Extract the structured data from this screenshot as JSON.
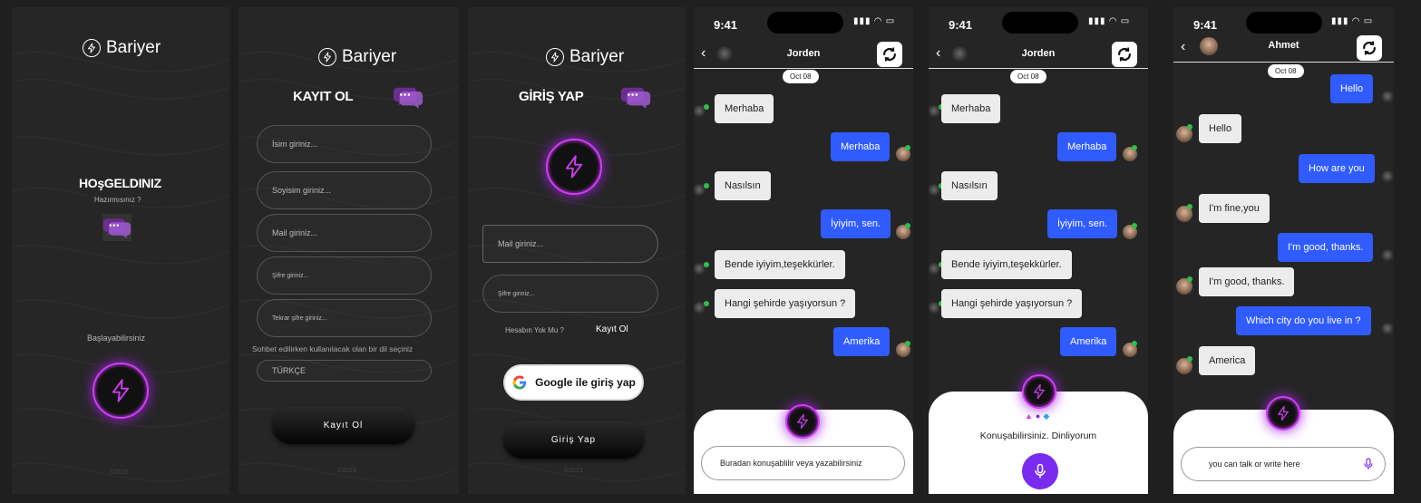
{
  "brand": "Bariyer",
  "welcome": {
    "title": "HOşGELDINIZ",
    "subtitle": "Hazırmısınız ?",
    "start_label": "Başlayabilirsiniz",
    "copyright": "©2023"
  },
  "register": {
    "title": "KAYIT OL",
    "fields": [
      "İsim giriniz...",
      "Soyisim giriniz...",
      "Mail giriniz...",
      "Şifre giriniz...",
      "Tekrar şifre giriniz..."
    ],
    "language_hint": "Sohbet edilirken kullanılacak olan bir dil seçiniz",
    "language_value": "TÜRKÇE",
    "submit_label": "Kayıt Ol",
    "copyright": "©2023"
  },
  "login": {
    "title": "GİRİŞ YAP",
    "fields": [
      "Mail giriniz...",
      "Şifre giriniz..."
    ],
    "no_account": "Hesabın Yok Mu ?",
    "register_link": "Kayıt Ol",
    "google_label": "Google ile giriş yap",
    "submit_label": "Giriş Yap",
    "copyright": "©2023"
  },
  "chat1": {
    "time": "9:41",
    "contact": "Jorden",
    "date": "Oct 08",
    "messages": [
      {
        "side": "in",
        "text": "Merhaba"
      },
      {
        "side": "out",
        "text": "Merhaba"
      },
      {
        "side": "in",
        "text": "Nasılsın"
      },
      {
        "side": "out",
        "text": "İyiyim, sen."
      },
      {
        "side": "in",
        "text": "Bende iyiyim,teşekkürler."
      },
      {
        "side": "in",
        "text": "Hangi şehirde yaşıyorsun ?"
      },
      {
        "side": "out",
        "text": "Amerika"
      }
    ],
    "input_placeholder": "Buradan konuşablilir veya yazabilirsiniz"
  },
  "chat2": {
    "time": "9:41",
    "contact": "Jorden",
    "date": "Oct 08",
    "messages": [
      {
        "side": "in",
        "text": "Merhaba"
      },
      {
        "side": "out",
        "text": "Merhaba"
      },
      {
        "side": "in",
        "text": "Nasılsın"
      },
      {
        "side": "out",
        "text": "İyiyim, sen."
      },
      {
        "side": "in",
        "text": "Bende iyiyim,teşekkürler."
      },
      {
        "side": "in",
        "text": "Hangi şehirde yaşıyorsun ?"
      },
      {
        "side": "out",
        "text": "Amerika"
      }
    ],
    "listening_label": "Konuşabilirsiniz. Dinliyorum"
  },
  "chat3": {
    "time": "9:41",
    "contact": "Ahmet",
    "date": "Oct 08",
    "messages": [
      {
        "side": "out",
        "text": "Hello"
      },
      {
        "side": "in",
        "text": "Hello"
      },
      {
        "side": "out",
        "text": "How are you"
      },
      {
        "side": "in",
        "text": "I'm fine,you"
      },
      {
        "side": "out",
        "text": "I'm good, thanks."
      },
      {
        "side": "in",
        "text": "I'm good, thanks."
      },
      {
        "side": "out",
        "text": "Which city do you live in ?"
      },
      {
        "side": "in",
        "text": "America"
      }
    ],
    "input_placeholder": "you can talk or write here"
  },
  "colors": {
    "accent_purple": "#d13cf5",
    "bubble_blue": "#2f5bff",
    "online_green": "#2fbf4a",
    "mic_purple": "#7a2bf0"
  }
}
